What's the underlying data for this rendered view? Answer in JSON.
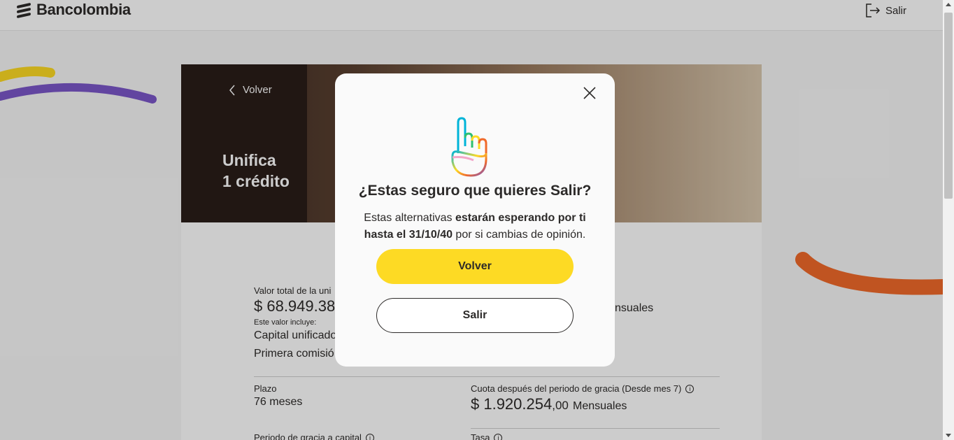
{
  "header": {
    "brand": "Bancolombia",
    "exit_label": "Salir"
  },
  "hero": {
    "back_label": "Volver",
    "title_line1": "Unifica",
    "title_line2": "1 crédito"
  },
  "summary": {
    "total_label": "Valor total de la uni",
    "total_value": "$ 68.949.38",
    "includes_label": "Este valor incluye:",
    "capital_label": "Capital unificado",
    "commission_label": "Primera comisió",
    "monthly_unit": "nsuales",
    "term_label": "Plazo",
    "term_value": "76 meses",
    "fee_after_label": "Cuota después del periodo de gracia (Desde mes 7)",
    "fee_after_int": "$ 1.920.254",
    "fee_after_dec": ",00",
    "fee_after_unit": "Mensuales",
    "grace_label": "Periodo de gracia a capital",
    "rate_label": "Tasa"
  },
  "modal": {
    "title": "¿Estas seguro que quieres Salir?",
    "text_part1": "Estas alternativas ",
    "text_bold": "estarán esperando por ti hasta el 31/10/40",
    "text_part2": " por si cambias de opinión.",
    "primary_button": "Volver",
    "secondary_button": "Salir",
    "close_icon": "close-icon"
  },
  "colors": {
    "brand_yellow": "#fdda24",
    "text_dark": "#2c2a29",
    "deco_purple": "#7b57c9",
    "deco_orange": "#f06a2a"
  }
}
